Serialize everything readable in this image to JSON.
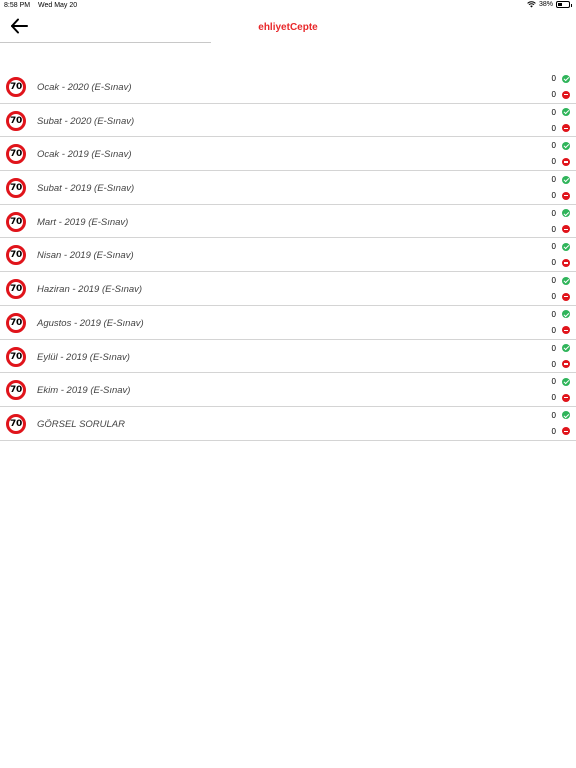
{
  "status_bar": {
    "time": "8:58 PM",
    "date": "Wed May 20",
    "battery": "38%",
    "battery_level": 0.38
  },
  "nav": {
    "title": "ehliyetCepte",
    "title_color": "#e8282b",
    "back_icon": "arrow-left-icon"
  },
  "sign_text": "70",
  "rows": [
    {
      "label": "Ocak - 2020  (E-Sınav)",
      "correct": "0",
      "wrong": "0"
    },
    {
      "label": "Subat - 2020 (E-Sınav)",
      "correct": "0",
      "wrong": "0"
    },
    {
      "label": "Ocak - 2019 (E-Sınav)",
      "correct": "0",
      "wrong": "0"
    },
    {
      "label": "Subat - 2019 (E-Sınav)",
      "correct": "0",
      "wrong": "0"
    },
    {
      "label": "Mart - 2019 (E-Sınav)",
      "correct": "0",
      "wrong": "0"
    },
    {
      "label": "Nisan - 2019 (E-Sınav)",
      "correct": "0",
      "wrong": "0"
    },
    {
      "label": "Haziran - 2019 (E-Sınav)",
      "correct": "0",
      "wrong": "0"
    },
    {
      "label": "Agustos - 2019 (E-Sınav)",
      "correct": "0",
      "wrong": "0"
    },
    {
      "label": "Eylül - 2019 (E-Sınav)",
      "correct": "0",
      "wrong": "0"
    },
    {
      "label": "Ekim - 2019 (E-Sınav)",
      "correct": "0",
      "wrong": "0"
    },
    {
      "label": "GÖRSEL SORULAR",
      "correct": "0",
      "wrong": "0"
    }
  ],
  "colors": {
    "correct": "#2fb45a",
    "wrong": "#e0141b",
    "sign_border": "#e0141b"
  }
}
